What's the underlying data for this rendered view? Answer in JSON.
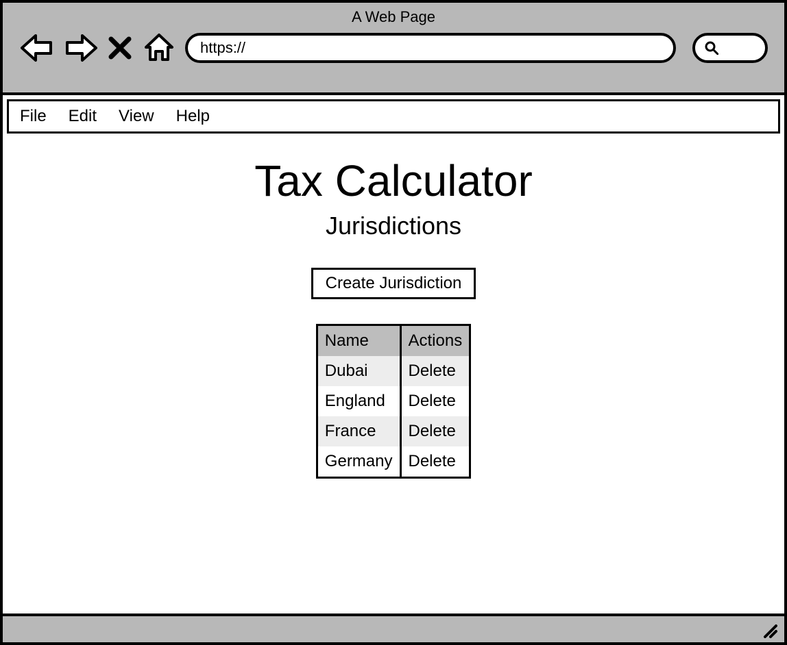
{
  "browser": {
    "title": "A Web Page",
    "url": "https://"
  },
  "menubar": {
    "items": [
      "File",
      "Edit",
      "View",
      "Help"
    ]
  },
  "page": {
    "title": "Tax Calculator",
    "subtitle": "Jurisdictions",
    "create_button_label": "Create Jurisdiction"
  },
  "table": {
    "headers": {
      "name": "Name",
      "actions": "Actions"
    },
    "rows": [
      {
        "name": "Dubai",
        "action": "Delete"
      },
      {
        "name": "England",
        "action": "Delete"
      },
      {
        "name": "France",
        "action": "Delete"
      },
      {
        "name": "Germany",
        "action": "Delete"
      }
    ]
  }
}
